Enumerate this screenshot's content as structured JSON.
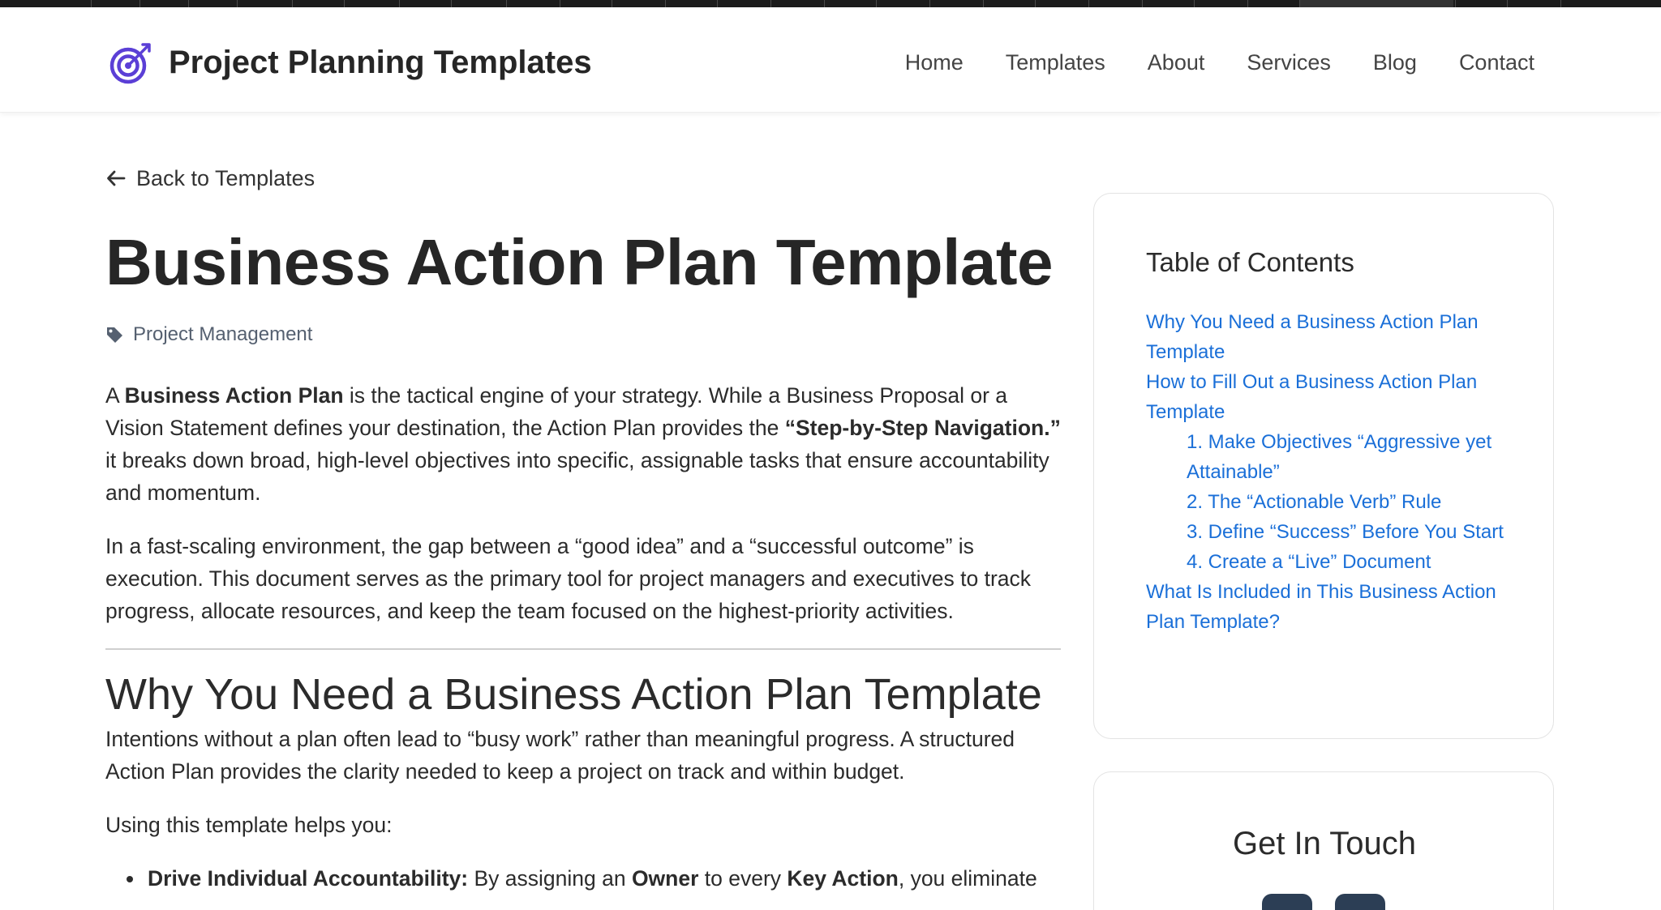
{
  "header": {
    "site_title": "Project Planning Templates",
    "logo_icon": "target-arrow-icon",
    "nav": [
      "Home",
      "Templates",
      "About",
      "Services",
      "Blog",
      "Contact"
    ]
  },
  "back_link": {
    "label": "Back to Templates",
    "icon": "arrow-left-icon"
  },
  "article": {
    "title": "Business Action Plan Template",
    "category": {
      "icon": "tag-icon",
      "label": "Project Management"
    },
    "intro": {
      "p1": {
        "a": "A ",
        "b1": "Business Action Plan",
        "c": " is the tactical engine of your strategy. While a Business Proposal or a Vision Statement defines your destination, the Action Plan provides the ",
        "b2": "“Step-by-Step Navigation.”",
        "d": " it breaks down broad, high-level objectives into specific, assignable tasks that ensure accountability and momentum."
      },
      "p2": "In a fast-scaling environment, the gap between a “good idea” and a “successful outcome” is execution. This document serves as the primary tool for project managers and executives to track progress, allocate resources, and keep the team focused on the highest-priority activities."
    },
    "section1": {
      "heading": "Why You Need a Business Action Plan Template",
      "p1": "Intentions without a plan often lead to “busy work” rather than meaningful progress. A structured Action Plan provides the clarity needed to keep a project on track and within budget.",
      "p2": "Using this template helps you:",
      "bullet1": {
        "lead": "Drive Individual Accountability:",
        "a": " By assigning an ",
        "b1": "Owner",
        "c": " to every ",
        "b2": "Key Action",
        "d": ", you eliminate"
      }
    }
  },
  "toc": {
    "title": "Table of Contents",
    "items": [
      "Why You Need a Business Action Plan Template",
      "How to Fill Out a Business Action Plan Template",
      "1. Make Objectives “Aggressive yet Attainable”",
      "2. The “Actionable Verb” Rule",
      "3. Define “Success” Before You Start",
      "4. Create a “Live” Document",
      "What Is Included in This Business Action Plan Template?"
    ]
  },
  "contact": {
    "title": "Get In Touch"
  },
  "colors": {
    "link": "#1a6fd8",
    "logo": "#5b3fd6",
    "text": "#2b2b2b",
    "social": "#2c3e55"
  }
}
